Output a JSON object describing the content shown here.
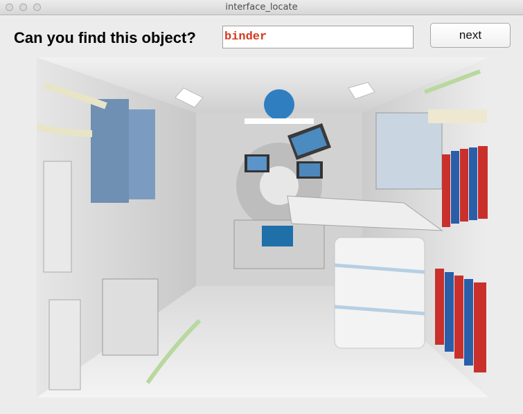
{
  "window": {
    "title": "interface_locate"
  },
  "prompt": {
    "text": "Can you find this object?"
  },
  "answer": {
    "value": "binder"
  },
  "controls": {
    "next_label": "next"
  },
  "colors": {
    "answer_text": "#d23a1f",
    "background": "#ececec"
  },
  "image": {
    "alt": "Space station module interior with laptops, storage bags and binders"
  }
}
